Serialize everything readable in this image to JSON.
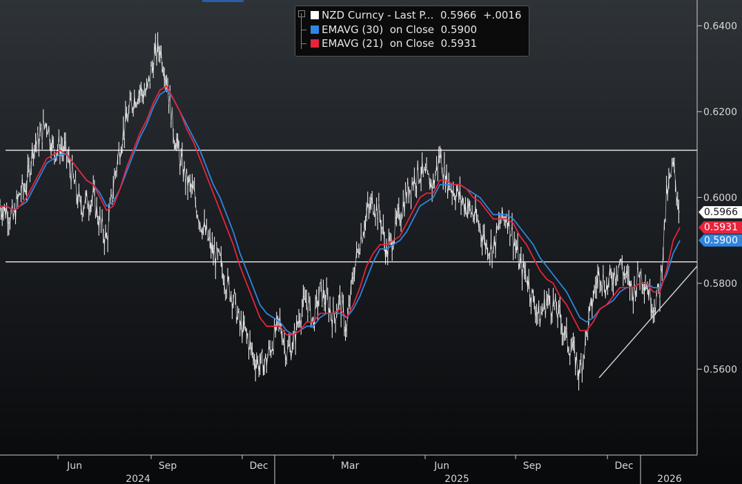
{
  "chart_data": {
    "type": "line",
    "y_axis": {
      "ticks": [
        0.64,
        0.62,
        0.6,
        0.58,
        0.56
      ],
      "tick_labels": [
        "0.6400",
        "0.6200",
        "0.6000",
        "0.5800",
        "0.5600"
      ],
      "ylim": [
        0.54,
        0.646
      ],
      "position": "right"
    },
    "x_axis": {
      "month_labels": [
        "Jun",
        "Sep",
        "Dec",
        "Mar",
        "Jun",
        "Sep",
        "Dec"
      ],
      "year_labels": [
        "2024",
        "2025",
        "2026"
      ]
    },
    "series": [
      {
        "name": "NZD Curncy - Last P...",
        "color": "#ffffff",
        "last_value": "0.5966",
        "change": "+.0016",
        "values": [
          0.598,
          0.597,
          0.595,
          0.601,
          0.603,
          0.612,
          0.614,
          0.618,
          0.611,
          0.612,
          0.61,
          0.604,
          0.598,
          0.599,
          0.6,
          0.594,
          0.59,
          0.603,
          0.612,
          0.618,
          0.623,
          0.625,
          0.624,
          0.632,
          0.635,
          0.628,
          0.616,
          0.609,
          0.604,
          0.601,
          0.595,
          0.591,
          0.587,
          0.585,
          0.58,
          0.577,
          0.57,
          0.568,
          0.563,
          0.561,
          0.562,
          0.567,
          0.571,
          0.564,
          0.566,
          0.573,
          0.576,
          0.571,
          0.578,
          0.576,
          0.572,
          0.576,
          0.569,
          0.582,
          0.59,
          0.596,
          0.599,
          0.596,
          0.587,
          0.591,
          0.596,
          0.601,
          0.604,
          0.606,
          0.604,
          0.603,
          0.61,
          0.604,
          0.602,
          0.6,
          0.598,
          0.596,
          0.593,
          0.589,
          0.588,
          0.594,
          0.596,
          0.591,
          0.584,
          0.582,
          0.576,
          0.572,
          0.576,
          0.575,
          0.572,
          0.567,
          0.564,
          0.559,
          0.568,
          0.577,
          0.583,
          0.579,
          0.582,
          0.585,
          0.581,
          0.578,
          0.583,
          0.58,
          0.575,
          0.578,
          0.6,
          0.607,
          0.5966
        ]
      },
      {
        "name": "EMAVG (30)  on Close",
        "color": "#2f86e0",
        "last_value": "0.5900",
        "values": [
          0.598,
          0.598,
          0.597,
          0.598,
          0.599,
          0.602,
          0.605,
          0.608,
          0.609,
          0.61,
          0.61,
          0.608,
          0.606,
          0.604,
          0.603,
          0.601,
          0.598,
          0.599,
          0.602,
          0.606,
          0.61,
          0.614,
          0.617,
          0.621,
          0.624,
          0.625,
          0.623,
          0.62,
          0.617,
          0.614,
          0.611,
          0.607,
          0.603,
          0.6,
          0.596,
          0.592,
          0.587,
          0.583,
          0.579,
          0.575,
          0.573,
          0.572,
          0.571,
          0.569,
          0.568,
          0.569,
          0.57,
          0.57,
          0.572,
          0.573,
          0.573,
          0.573,
          0.572,
          0.574,
          0.577,
          0.581,
          0.585,
          0.588,
          0.588,
          0.589,
          0.59,
          0.592,
          0.595,
          0.598,
          0.599,
          0.6,
          0.603,
          0.603,
          0.603,
          0.603,
          0.602,
          0.601,
          0.6,
          0.598,
          0.596,
          0.596,
          0.596,
          0.595,
          0.593,
          0.591,
          0.589,
          0.586,
          0.584,
          0.582,
          0.58,
          0.578,
          0.575,
          0.572,
          0.571,
          0.572,
          0.574,
          0.575,
          0.576,
          0.578,
          0.579,
          0.579,
          0.58,
          0.58,
          0.579,
          0.579,
          0.582,
          0.587,
          0.59
        ]
      },
      {
        "name": "EMAVG (21)  on Close",
        "color": "#e8243c",
        "last_value": "0.5931",
        "values": [
          0.598,
          0.598,
          0.597,
          0.598,
          0.6,
          0.603,
          0.606,
          0.609,
          0.61,
          0.611,
          0.61,
          0.608,
          0.606,
          0.604,
          0.603,
          0.6,
          0.597,
          0.598,
          0.602,
          0.607,
          0.611,
          0.615,
          0.618,
          0.622,
          0.625,
          0.626,
          0.623,
          0.62,
          0.616,
          0.613,
          0.609,
          0.605,
          0.601,
          0.597,
          0.593,
          0.589,
          0.584,
          0.58,
          0.576,
          0.572,
          0.57,
          0.57,
          0.57,
          0.568,
          0.568,
          0.569,
          0.571,
          0.571,
          0.573,
          0.573,
          0.573,
          0.574,
          0.572,
          0.575,
          0.579,
          0.584,
          0.587,
          0.589,
          0.589,
          0.59,
          0.591,
          0.594,
          0.597,
          0.6,
          0.601,
          0.601,
          0.604,
          0.604,
          0.603,
          0.603,
          0.602,
          0.6,
          0.599,
          0.597,
          0.595,
          0.595,
          0.595,
          0.594,
          0.591,
          0.589,
          0.586,
          0.583,
          0.581,
          0.58,
          0.577,
          0.575,
          0.572,
          0.569,
          0.569,
          0.571,
          0.574,
          0.575,
          0.577,
          0.579,
          0.579,
          0.579,
          0.58,
          0.58,
          0.578,
          0.578,
          0.583,
          0.59,
          0.593
        ]
      }
    ],
    "horizontal_lines": [
      0.611,
      0.585
    ],
    "trendline": [
      [
        0.558,
        0.584
      ]
    ],
    "grid": false,
    "legend": "top-center"
  },
  "legend": {
    "rows": [
      {
        "text": "NZD Curncy - Last P...  0.5966  +.0016",
        "color": "#ffffff"
      },
      {
        "text": "EMAVG (30)  on Close  0.5900",
        "color": "#2f86e0"
      },
      {
        "text": "EMAVG (21)  on Close  0.5931",
        "color": "#e8243c"
      }
    ]
  },
  "price_tags": [
    {
      "label": "0.5966",
      "bg": "#ffffff",
      "fg": "#111111"
    },
    {
      "label": "0.5931",
      "bg": "#e8243c",
      "fg": "#ffffff"
    },
    {
      "label": "0.5900",
      "bg": "#2f86e0",
      "fg": "#ffffff"
    }
  ]
}
